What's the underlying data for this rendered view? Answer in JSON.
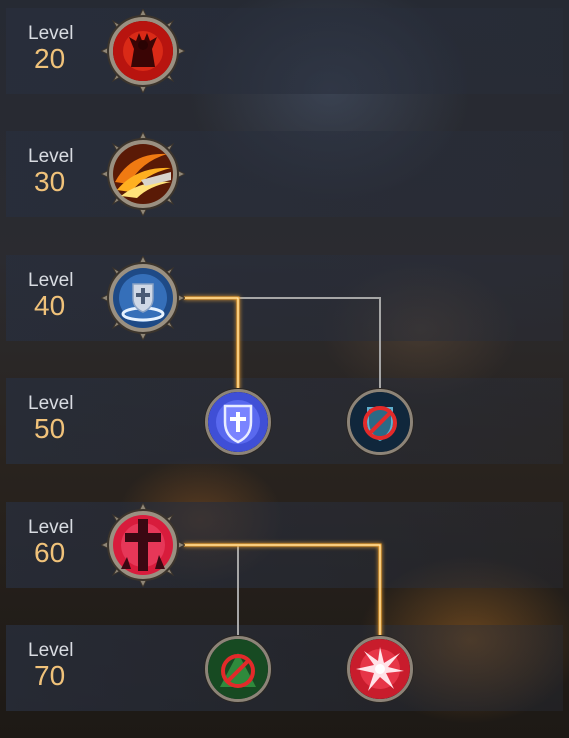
{
  "tree": {
    "rows": [
      {
        "label": "Level",
        "level": "20"
      },
      {
        "label": "Level",
        "level": "30"
      },
      {
        "label": "Level",
        "level": "40"
      },
      {
        "label": "Level",
        "level": "50"
      },
      {
        "label": "Level",
        "level": "60"
      },
      {
        "label": "Level",
        "level": "70"
      }
    ],
    "skills": [
      {
        "name": "rage-skill-icon",
        "level": "20"
      },
      {
        "name": "flame-slash-skill-icon",
        "level": "30"
      },
      {
        "name": "holy-shield-aura-skill-icon",
        "level": "40"
      },
      {
        "name": "holy-shield-skill-icon",
        "level": "50",
        "selected": true
      },
      {
        "name": "no-shield-skill-icon",
        "level": "50",
        "selected": false
      },
      {
        "name": "blood-cross-skill-icon",
        "level": "60"
      },
      {
        "name": "no-heal-skill-icon",
        "level": "70",
        "selected": false
      },
      {
        "name": "burst-strike-skill-icon",
        "level": "70",
        "selected": true
      }
    ]
  },
  "colors": {
    "level_number": "#f0c27a",
    "level_label": "#d9dce2",
    "active_path": "#f2a531",
    "inactive_path": "#a6a6a6"
  }
}
